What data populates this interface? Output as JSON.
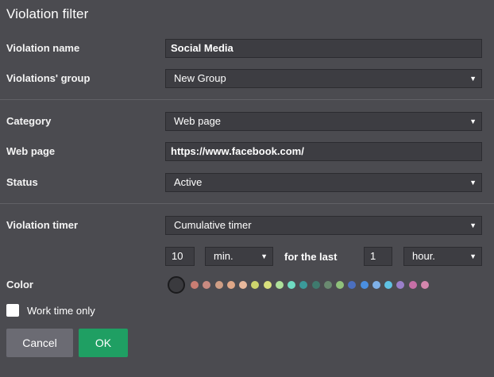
{
  "dialog": {
    "title": "Violation filter"
  },
  "fields": {
    "violation_name": {
      "label": "Violation name",
      "value": "Social Media"
    },
    "violations_group": {
      "label": "Violations' group",
      "value": "New Group"
    },
    "category": {
      "label": "Category",
      "value": "Web page"
    },
    "web_page": {
      "label": "Web page",
      "value": "https://www.facebook.com/"
    },
    "status": {
      "label": "Status",
      "value": "Active"
    },
    "violation_timer": {
      "label": "Violation timer",
      "value": "Cumulative timer"
    }
  },
  "timer": {
    "amount": "10",
    "unit": "min.",
    "for_the_last_label": "for the last",
    "period_amount": "1",
    "period_unit": "hour."
  },
  "color": {
    "label": "Color",
    "selected": "#3a3a3e",
    "palette": [
      "#c97d73",
      "#c98a80",
      "#cf9e85",
      "#e0a888",
      "#e8b89c",
      "#cdd46d",
      "#d9e07d",
      "#aee09a",
      "#6fdcc3",
      "#3b9a9a",
      "#3f7a6e",
      "#6a8a70",
      "#8fc17a",
      "#4b6fbf",
      "#4a8fe0",
      "#7fb1e8",
      "#5fc2e3",
      "#9a7fc9",
      "#c66fa6",
      "#d487ad"
    ]
  },
  "work_time_only": {
    "label": "Work time only",
    "checked": false
  },
  "buttons": {
    "cancel": "Cancel",
    "ok": "OK"
  },
  "icons": {
    "dropdown": "chevron-down-icon"
  }
}
